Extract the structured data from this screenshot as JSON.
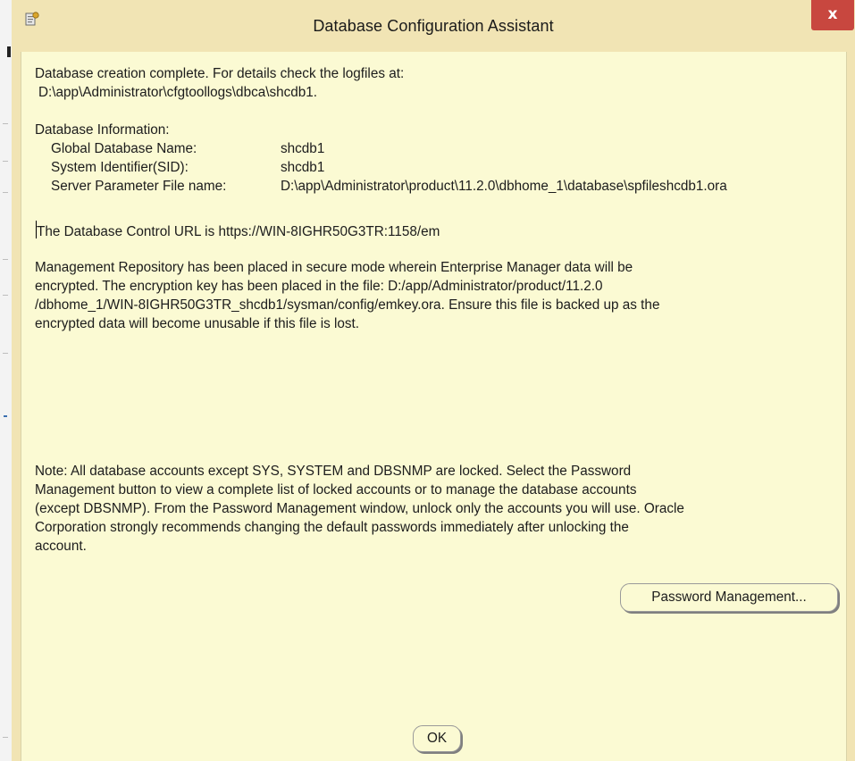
{
  "window": {
    "title": "Database Configuration Assistant",
    "close_glyph": "x",
    "app_icon": "dbca-app-icon",
    "colors": {
      "frame": "#f1e4b4",
      "content": "#fbfad3",
      "close": "#c8473f"
    }
  },
  "message": {
    "line1": "Database creation complete. For details check the logfiles at:",
    "line2": "D:\\app\\Administrator\\cfgtoollogs\\dbca\\shcdb1.",
    "info_heading": "Database Information:",
    "info": [
      {
        "label": "Global Database Name:",
        "value": "shcdb1"
      },
      {
        "label": "System Identifier(SID):",
        "value": "shcdb1"
      },
      {
        "label": "Server Parameter File name:",
        "value": "D:\\app\\Administrator\\product\\11.2.0\\dbhome_1\\database\\spfileshcdb1.ora"
      }
    ],
    "control_url": "The Database Control URL is https://WIN-8IGHR50G3TR:1158/em",
    "mgmt_lines": [
      "Management Repository has been placed in secure mode wherein Enterprise Manager data will be",
      "encrypted.  The encryption key has been placed in the file: D:/app/Administrator/product/11.2.0",
      "/dbhome_1/WIN-8IGHR50G3TR_shcdb1/sysman/config/emkey.ora. Ensure this file is backed up as the",
      "encrypted data will become unusable if this file is lost."
    ],
    "note_lines": [
      "Note: All database accounts except SYS, SYSTEM and DBSNMP are locked. Select the Password",
      "Management button to view a complete list of locked accounts or to manage the database accounts",
      "(except DBSNMP). From the Password Management window, unlock only the accounts you will use. Oracle",
      "Corporation strongly recommends changing the default passwords immediately after unlocking the",
      "account."
    ]
  },
  "buttons": {
    "password_management": "Password Management...",
    "ok": "OK"
  }
}
